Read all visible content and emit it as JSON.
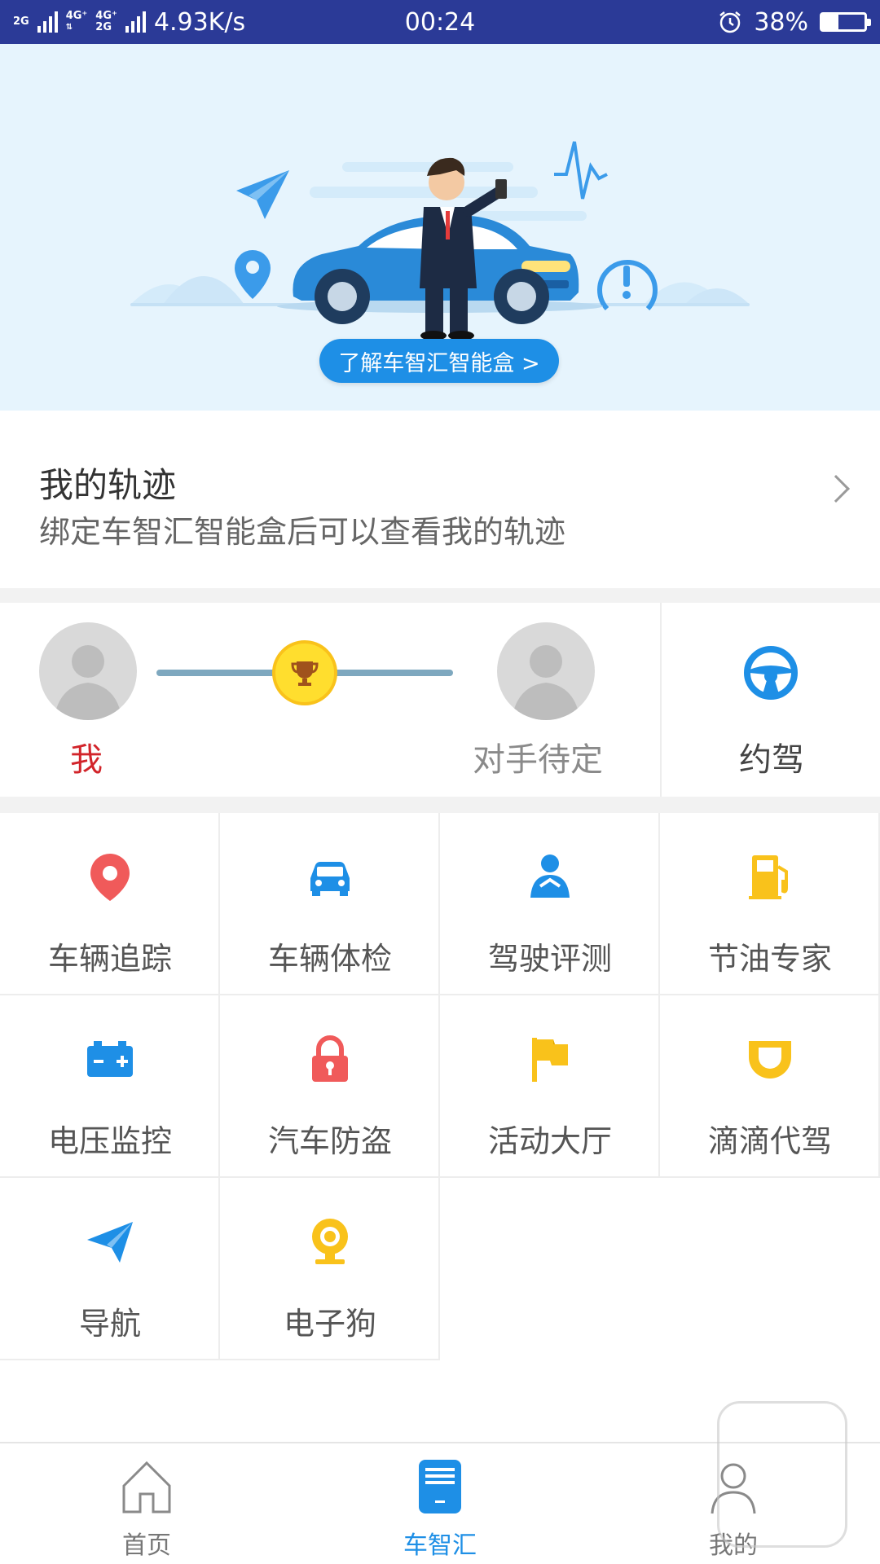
{
  "status_bar": {
    "net1": "2G",
    "net2": "4G⁺",
    "net3": "4G⁺",
    "net4": "2G",
    "speed": "4.93K/s",
    "time": "00:24",
    "battery": "38%",
    "battery_level": 0.38
  },
  "banner": {
    "button_label": "了解车智汇智能盒 >"
  },
  "track": {
    "title": "我的轨迹",
    "subtitle": "绑定车智汇智能盒后可以查看我的轨迹"
  },
  "pk": {
    "me_label": "我",
    "opponent_label": "对手待定",
    "date_label": "约驾"
  },
  "grid": {
    "items": [
      {
        "label": "车辆追踪",
        "icon": "location-pin-icon",
        "color": "#f05a5a"
      },
      {
        "label": "车辆体检",
        "icon": "car-icon",
        "color": "#1e8fe6"
      },
      {
        "label": "驾驶评测",
        "icon": "driver-icon",
        "color": "#1e8fe6"
      },
      {
        "label": "节油专家",
        "icon": "fuel-pump-icon",
        "color": "#f9c21b"
      },
      {
        "label": "电压监控",
        "icon": "battery-icon",
        "color": "#1e8fe6"
      },
      {
        "label": "汽车防盗",
        "icon": "lock-icon",
        "color": "#f05a5a"
      },
      {
        "label": "活动大厅",
        "icon": "flag-icon",
        "color": "#f9c21b"
      },
      {
        "label": "滴滴代驾",
        "icon": "didi-icon",
        "color": "#f9c21b"
      },
      {
        "label": "导航",
        "icon": "paper-plane-icon",
        "color": "#1e8fe6"
      },
      {
        "label": "电子狗",
        "icon": "webcam-icon",
        "color": "#f9c21b"
      }
    ]
  },
  "nav": {
    "home": "首页",
    "chezhihui": "车智汇",
    "mine": "我的"
  }
}
